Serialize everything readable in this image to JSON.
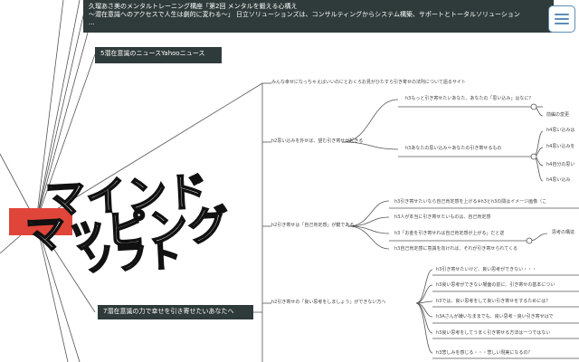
{
  "header": {
    "title_line1": "久瑠あさ美のメンタルトレーニング構座「第2回 メンタルを鍛える心構え",
    "title_line2": "〜潜在意識へのアクセスで人生は劇的に変わる〜」 日立ソリューションズは、コンサルティングからシステム構築、サポートとトータルソリューション",
    "title_line3": "..."
  },
  "nodes": {
    "news": "5潜在意識のニュースYahooニュース",
    "attract": "7潜在意識の力で幸せを引き寄せたいあなたへ",
    "intro": "みんな幸せになっちゃえばいいのにとおくろお見がひたすら引き寄せの法則について語るサイト",
    "b1": "h2思い込みを外せば、望む引き寄せが起きる",
    "b1a": "h3もっと引き寄せたいあなた、あなたの「思い込み」はなに？",
    "b1a1": "前編の変更",
    "b1b": "h3あなたの思い込み＝あなたの引き寄せるもの",
    "b1b1": "h4思い込みは",
    "b1b2": "h4思い込みを",
    "b1b3": "h4自分の思い",
    "b1b4": "h4思い込み",
    "b2": "h2引き寄せは「自己肯定感」が鍵である",
    "b2a": "h3引き寄せたいなら自己肯定感を上げる※h3とh3の間はイメージ画像（こ",
    "b2b": "h3人が本当に引き寄せたいものは、自己肯定感",
    "b2c": "h3「お金を引き寄せれば自己肯定感が上がる」だと逆",
    "b2c1": "思考の構造",
    "b2d": "h3自己肯定感に意識を向ければ、それが引き寄せられてくる",
    "b3": "h2引き寄せの「良い思考をしましょう」ができない方へ",
    "b3a": "h3引き寄せたいけど、良い思考ができない・・・",
    "b3b": "h3良い思考ができない場面の前に、引き寄せの基本につい",
    "b3c": "h3では、良い思考をして良い引き寄せをするためには？",
    "b3d": "h3Aさんが嫌いなままでも、良い思考・良い引き寄せはで",
    "b3e": "h3良い思考をしてうまく引き寄せる方法は一つではない",
    "b3f": "h3悲しみを感じる・・・悲しい現実になるの？"
  },
  "logo": {
    "line1": "マインド",
    "line2": "マッピング",
    "line3": "ソフト"
  },
  "menu_icon": "hamburger-menu-icon",
  "colors": {
    "node_dark": "#2f3b3a",
    "logo_red": "#e0453a",
    "line": "#555555",
    "menu_border": "#5c8db8"
  }
}
